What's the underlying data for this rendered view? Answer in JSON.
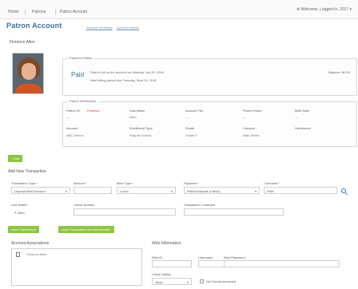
{
  "breadcrumb": {
    "home": "Home",
    "patrons": "Patrons",
    "current": "Patron Account"
  },
  "top_right": "⚙ Welcome, Logged in, 2017 ▾",
  "page": {
    "title": "Patron Account",
    "links": [
      "Account Summary",
      "Account Activity"
    ],
    "patron_name": "Florence Allen"
  },
  "payment_box": {
    "title": "Payment Status",
    "status": "Paid",
    "line1": "Paid in full on the account on Monday, Jun 20, 2016",
    "line2": "Next billing period due Tuesday, Sept 13, 2016",
    "balance": "Balance: $0.00"
  },
  "info_box": {
    "title": "Patron Information",
    "row1_labels": [
      "Patron ID",
      "Florence",
      "Last Name",
      "Account Tier",
      "Phone Home",
      "Birth Date"
    ],
    "row1_values": [
      "—",
      "",
      "Allen",
      "—",
      "—",
      "—"
    ],
    "row2_labels": [
      "Account",
      "Enrollment Type",
      "Grade",
      "Campus",
      "Homeroom"
    ],
    "row2_values": [
      "ABC School",
      "Regular School",
      "Grade 5",
      "Main Street",
      ""
    ]
  },
  "add_button": "+ Add",
  "sub_heading": "Add New Transaction",
  "form": {
    "transaction_type_label": "Transaction Type *",
    "transaction_type_value": "Deposit Meal Account",
    "amount_label": "Amount *",
    "amount_value": "",
    "meal_type_label": "Meal Type *",
    "meal_type_value": "Lunch",
    "payment_label": "Payment *",
    "payment_value": "Parent Deposit (Check)",
    "comment_label": "Comment *",
    "comment_value": "Paid",
    "line3_label": "Line Notes *",
    "line3_value": "F. Allen",
    "check_number_label": "Check Number",
    "check_number_value": "",
    "transaction_comment_label": "Transaction Comment",
    "transaction_comment_value": ""
  },
  "buttons": {
    "save": "Save Transaction",
    "save_another": "Save Transaction and Add Another"
  },
  "sections": {
    "associations_title": "Account Associations",
    "web_info_title": "Web Information"
  },
  "associations": [
    "Florence Allen"
  ],
  "web_info": {
    "id_label": "Web ID",
    "username_label": "Username",
    "password_label": "Web Password",
    "check_label": "Check Status",
    "check_value": "Allow",
    "accepted_label": "No Checks Accepted",
    "accepted_checked": false
  }
}
